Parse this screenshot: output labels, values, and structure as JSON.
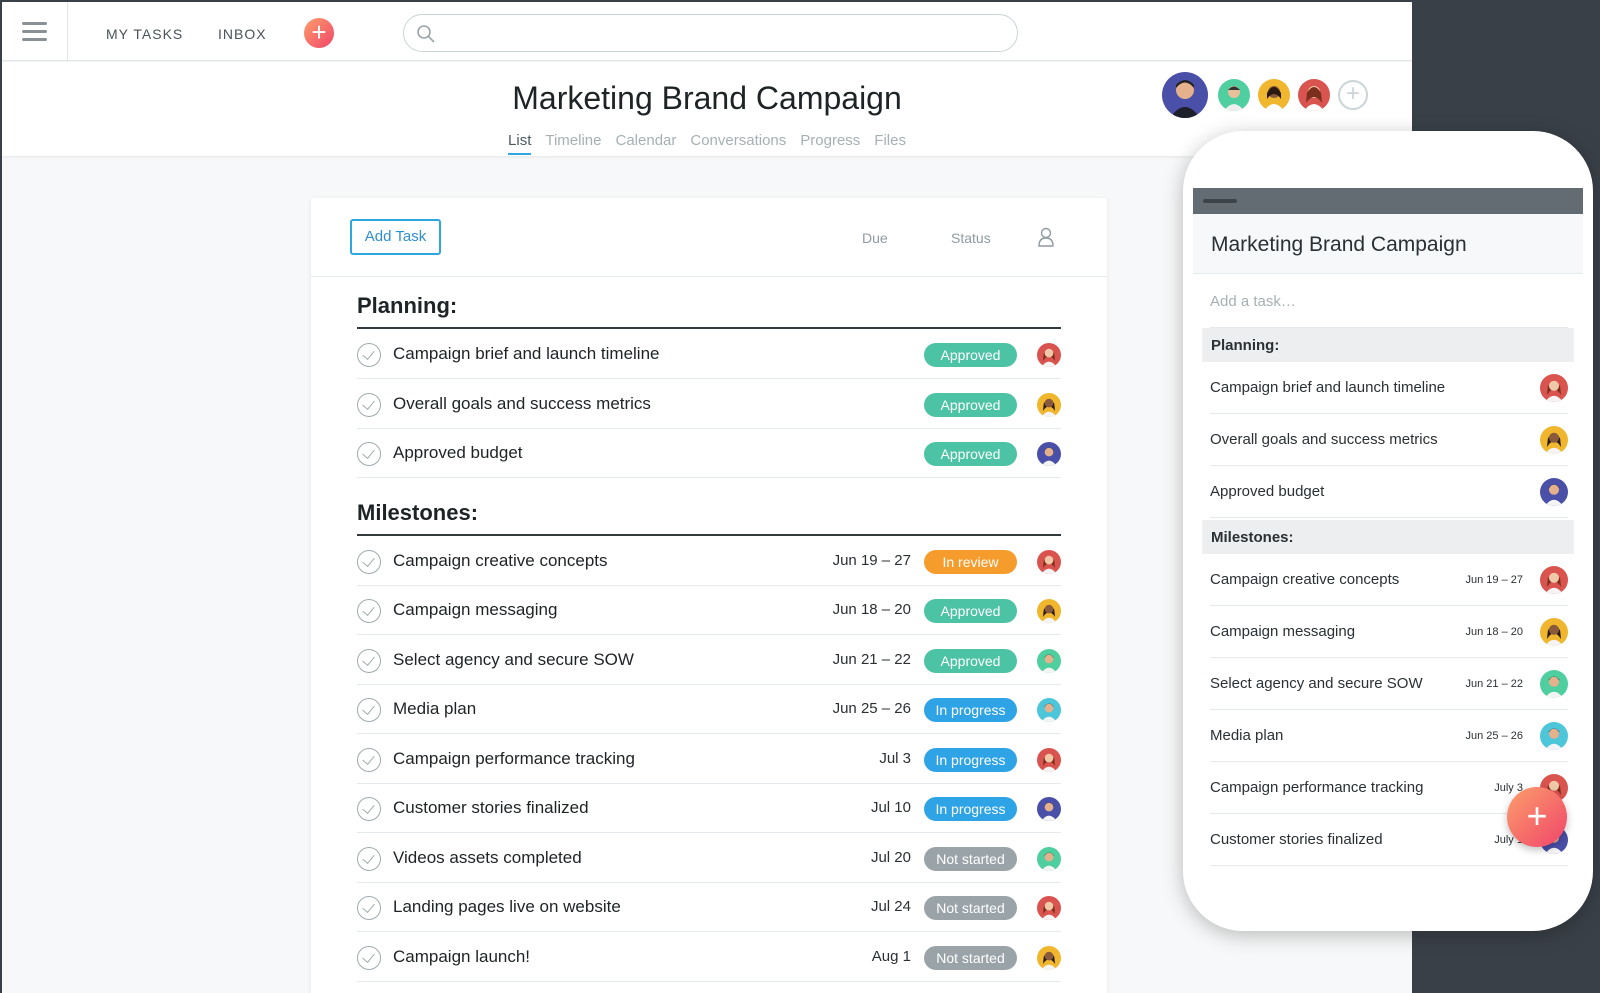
{
  "nav": {
    "my_tasks": "MY TASKS",
    "inbox": "INBOX",
    "add_symbol": "+"
  },
  "search": {
    "placeholder": ""
  },
  "project": {
    "title": "Marketing Brand Campaign",
    "tabs": [
      "List",
      "Timeline",
      "Calendar",
      "Conversations",
      "Progress",
      "Files"
    ],
    "active_tab": "List"
  },
  "list": {
    "add_task_label": "Add Task",
    "col_due": "Due",
    "col_status": "Status"
  },
  "sections": [
    {
      "title": "Planning:",
      "tasks": [
        {
          "name": "Campaign brief and launch timeline",
          "due": "",
          "status": "Approved",
          "avatar": "woman-red"
        },
        {
          "name": "Overall goals and success metrics",
          "due": "",
          "status": "Approved",
          "avatar": "woman-yellow"
        },
        {
          "name": "Approved budget",
          "due": "",
          "status": "Approved",
          "avatar": "man-purple"
        }
      ]
    },
    {
      "title": "Milestones:",
      "tasks": [
        {
          "name": "Campaign creative concepts",
          "due": "Jun 19 – 27",
          "status": "In review",
          "avatar": "woman-red"
        },
        {
          "name": "Campaign messaging",
          "due": "Jun 18 – 20",
          "status": "Approved",
          "avatar": "woman-yellow"
        },
        {
          "name": "Select agency and secure SOW",
          "due": "Jun 21 – 22",
          "status": "Approved",
          "avatar": "man-green"
        },
        {
          "name": "Media plan",
          "due": "Jun 25 – 26",
          "status": "In progress",
          "avatar": "man-teal"
        },
        {
          "name": "Campaign performance tracking",
          "due": "Jul 3",
          "status": "In progress",
          "avatar": "woman-red"
        },
        {
          "name": "Customer stories finalized",
          "due": "Jul 10",
          "status": "In progress",
          "avatar": "man-purple"
        },
        {
          "name": "Videos assets completed",
          "due": "Jul 20",
          "status": "Not started",
          "avatar": "man-green"
        },
        {
          "name": "Landing pages live on website",
          "due": "Jul 24",
          "status": "Not started",
          "avatar": "woman-red"
        },
        {
          "name": "Campaign launch!",
          "due": "Aug 1",
          "status": "Not started",
          "avatar": "woman-yellow"
        }
      ]
    }
  ],
  "status_colors": {
    "Approved": "#4cc3a5",
    "In review": "#f59c2c",
    "In progress": "#2ea3e6",
    "Not started": "#99a3a8"
  },
  "avatar_colors": {
    "woman-red": "#d9534f",
    "woman-yellow": "#f0b62e",
    "man-purple": "#4a4fa8",
    "man-green": "#4fcf9f",
    "man-teal": "#4cc6d8"
  },
  "mobile": {
    "title": "Marketing Brand Campaign",
    "add_placeholder": "Add a task…",
    "sections": [
      {
        "title": "Planning:",
        "tasks": [
          {
            "name": "Campaign brief and launch timeline",
            "due": "",
            "avatar": "woman-red"
          },
          {
            "name": "Overall goals and success metrics",
            "due": "",
            "avatar": "woman-yellow"
          },
          {
            "name": "Approved budget",
            "due": "",
            "avatar": "man-purple"
          }
        ]
      },
      {
        "title": "Milestones:",
        "tasks": [
          {
            "name": "Campaign creative concepts",
            "due": "Jun 19 – 27",
            "avatar": "woman-red"
          },
          {
            "name": "Campaign messaging",
            "due": "Jun 18 – 20",
            "avatar": "woman-yellow"
          },
          {
            "name": "Select agency and secure SOW",
            "due": "Jun 21 – 22",
            "avatar": "man-green"
          },
          {
            "name": "Media plan",
            "due": "Jun 25 – 26",
            "avatar": "man-teal"
          },
          {
            "name": "Campaign performance tracking",
            "due": "July 3",
            "avatar": "woman-red"
          },
          {
            "name": "Customer stories finalized",
            "due": "July 1",
            "avatar": "man-purple"
          }
        ]
      }
    ],
    "fab_symbol": "+"
  }
}
